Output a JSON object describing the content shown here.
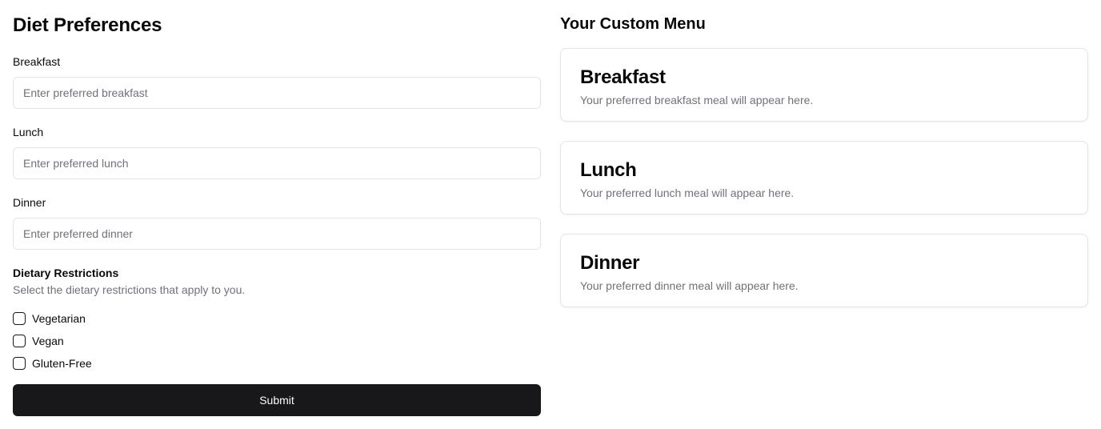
{
  "form": {
    "title": "Diet Preferences",
    "fields": [
      {
        "label": "Breakfast",
        "value": "",
        "placeholder": "Enter preferred breakfast"
      },
      {
        "label": "Lunch",
        "value": "",
        "placeholder": "Enter preferred lunch"
      },
      {
        "label": "Dinner",
        "value": "",
        "placeholder": "Enter preferred dinner"
      }
    ],
    "restrictions": {
      "label": "Dietary Restrictions",
      "description": "Select the dietary restrictions that apply to you.",
      "options": [
        {
          "label": "Vegetarian",
          "checked": false
        },
        {
          "label": "Vegan",
          "checked": false
        },
        {
          "label": "Gluten-Free",
          "checked": false
        }
      ]
    },
    "submit_label": "Submit"
  },
  "menu": {
    "title": "Your Custom Menu",
    "cards": [
      {
        "title": "Breakfast",
        "description": "Your preferred breakfast meal will appear here."
      },
      {
        "title": "Lunch",
        "description": "Your preferred lunch meal will appear here."
      },
      {
        "title": "Dinner",
        "description": "Your preferred dinner meal will appear here."
      }
    ]
  },
  "colors": {
    "primary": "#18181b",
    "muted_text": "#71717a",
    "border": "#e4e4e7"
  }
}
